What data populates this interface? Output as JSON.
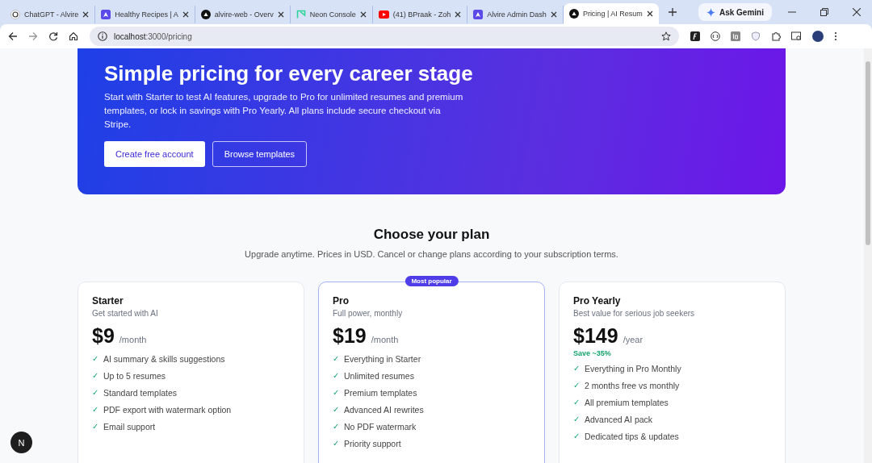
{
  "browser": {
    "tabs": [
      {
        "title": "ChatGPT - Alvire",
        "selected": false
      },
      {
        "title": "Healthy Recipes | A",
        "selected": false
      },
      {
        "title": "alvire-web - Overv",
        "selected": false
      },
      {
        "title": "Neon Console",
        "selected": false
      },
      {
        "title": "(41) BPraak - Zoh",
        "selected": false
      },
      {
        "title": "Alvire Admin Dash",
        "selected": false
      },
      {
        "title": "Pricing | AI Resum",
        "selected": true
      }
    ],
    "ask_button": "Ask Gemini",
    "address": {
      "host": "localhost",
      "path": ":3000/pricing"
    }
  },
  "hero": {
    "title": "Simple pricing for every career stage",
    "text": "Start with Starter to test AI features, upgrade to Pro for unlimited resumes and premium templates, or lock in savings with Pro Yearly. All plans include secure checkout via Stripe.",
    "buttons": [
      {
        "label": "Create free account",
        "kind": "primary"
      },
      {
        "label": "Browse templates",
        "kind": "outline"
      }
    ]
  },
  "plans_section": {
    "title": "Choose your plan",
    "subtitle": "Upgrade anytime. Prices in USD. Cancel or change plans according to your subscription terms.",
    "plans": [
      {
        "name": "Starter",
        "tagline": "Get started with AI",
        "price": "$9",
        "period": "/month",
        "highlighted": false,
        "features": [
          "AI summary & skills suggestions",
          "Up to 5 resumes",
          "Standard templates",
          "PDF export with watermark option",
          "Email support"
        ]
      },
      {
        "name": "Pro",
        "tagline": "Full power, monthly",
        "price": "$19",
        "period": "/month",
        "badge": "Most popular",
        "highlighted": true,
        "features": [
          "Everything in Starter",
          "Unlimited resumes",
          "Premium templates",
          "Advanced AI rewrites",
          "No PDF watermark",
          "Priority support"
        ]
      },
      {
        "name": "Pro Yearly",
        "tagline": "Best value for serious job seekers",
        "price": "$149",
        "period": "/year",
        "savings": "Save ~35%",
        "highlighted": false,
        "features": [
          "Everything in Pro Monthly",
          "2 months free vs monthly",
          "All premium templates",
          "Advanced AI pack",
          "Dedicated tips & updates"
        ]
      }
    ]
  },
  "dev_badge": "N",
  "check_mark": "✓"
}
